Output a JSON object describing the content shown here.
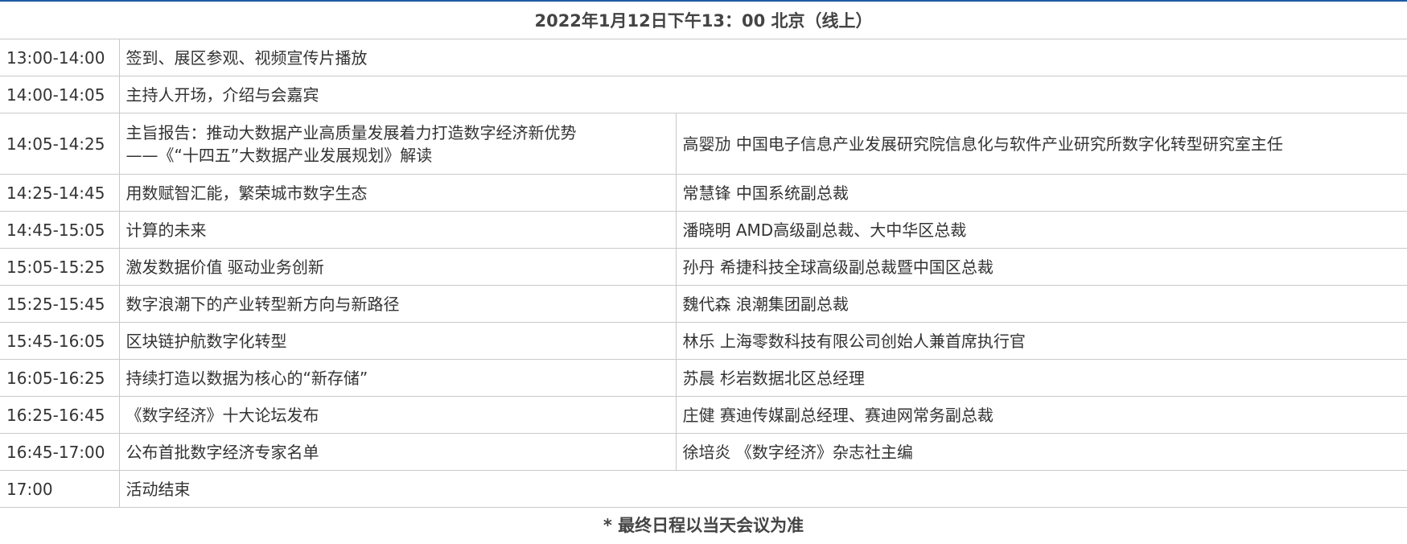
{
  "header": {
    "title": "2022年1月12日下午13：00 北京（线上）"
  },
  "rows": [
    {
      "time": "13:00-14:00",
      "topic": "签到、展区参观、视频宣传片播放",
      "speaker": ""
    },
    {
      "time": "14:00-14:05",
      "topic": "主持人开场，介绍与会嘉宾",
      "speaker": ""
    },
    {
      "time": "14:05-14:25",
      "topic_line1": "主旨报告：推动大数据产业高质量发展着力打造数字经济新优势",
      "topic_line2": "——《“十四五”大数据产业发展规划》解读",
      "speaker": "高婴劢 中国电子信息产业发展研究院信息化与软件产业研究所数字化转型研究室主任"
    },
    {
      "time": "14:25-14:45",
      "topic": "用数赋智汇能，繁荣城市数字生态",
      "speaker": "常慧锋 中国系统副总裁"
    },
    {
      "time": "14:45-15:05",
      "topic": "计算的未来",
      "speaker": "潘晓明 AMD高级副总裁、大中华区总裁"
    },
    {
      "time": "15:05-15:25",
      "topic": "激发数据价值 驱动业务创新",
      "speaker": "孙丹 希捷科技全球高级副总裁暨中国区总裁"
    },
    {
      "time": "15:25-15:45",
      "topic": "数字浪潮下的产业转型新方向与新路径",
      "speaker": "魏代森 浪潮集团副总裁"
    },
    {
      "time": "15:45-16:05",
      "topic": "区块链护航数字化转型",
      "speaker": "林乐 上海零数科技有限公司创始人兼首席执行官"
    },
    {
      "time": "16:05-16:25",
      "topic": "持续打造以数据为核心的“新存储”",
      "speaker": "苏晨 杉岩数据北区总经理"
    },
    {
      "time": "16:25-16:45",
      "topic": "《数字经济》十大论坛发布",
      "speaker": "庄健 赛迪传媒副总经理、赛迪网常务副总裁"
    },
    {
      "time": "16:45-17:00",
      "topic": "公布首批数字经济专家名单",
      "speaker": "徐培炎 《数字经济》杂志社主编"
    },
    {
      "time": "17:00",
      "topic": "活动结束",
      "speaker": ""
    }
  ],
  "footnote": "* 最终日程以当天会议为准",
  "colors": {
    "accent_bar": "#1f5aa6",
    "border": "#c9c9c9",
    "text": "#333333"
  }
}
